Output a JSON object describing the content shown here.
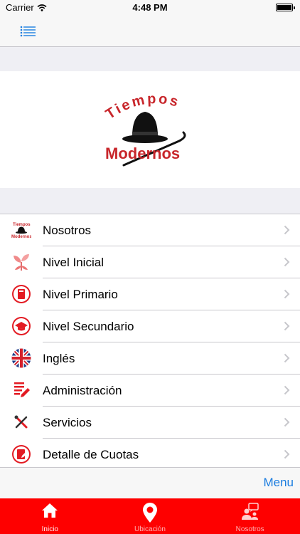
{
  "status_bar": {
    "carrier": "Carrier",
    "time": "4:48 PM"
  },
  "logo": {
    "line1": "Tiempos",
    "line2": "Modernos"
  },
  "menu": {
    "items": [
      {
        "label": "Nosotros",
        "icon": "hat-logo-icon"
      },
      {
        "label": "Nivel Inicial",
        "icon": "sprout-icon"
      },
      {
        "label": "Nivel Primario",
        "icon": "book-icon"
      },
      {
        "label": "Nivel Secundario",
        "icon": "graduation-cap-icon"
      },
      {
        "label": "Inglés",
        "icon": "uk-flag-icon"
      },
      {
        "label": "Administración",
        "icon": "document-edit-icon"
      },
      {
        "label": "Servicios",
        "icon": "tools-icon"
      },
      {
        "label": "Detalle de Cuotas",
        "icon": "invoice-icon"
      }
    ]
  },
  "toolbar": {
    "menu_label": "Menu"
  },
  "tabs": [
    {
      "label": "Inicio",
      "icon": "home-icon"
    },
    {
      "label": "Ubicación",
      "icon": "location-pin-icon"
    },
    {
      "label": "Nosotros",
      "icon": "people-chat-icon"
    }
  ],
  "colors": {
    "accent_red": "#fe0000",
    "link_blue": "#1b7de0",
    "logo_red": "#c8262b"
  }
}
